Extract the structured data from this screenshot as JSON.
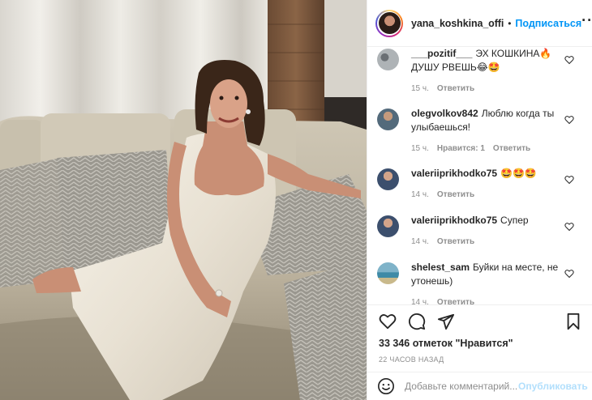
{
  "post": {
    "username": "yana_koshkina_offi",
    "separator": "•",
    "follow_label": "Подписаться",
    "more_label": "···",
    "comments": [
      {
        "username": "___pozitif___",
        "text": "ЭХ КОШКИНА🔥 ДУШУ РВЕШЬ😂🤩",
        "time": "15 ч.",
        "likes": "",
        "reply": "Ответить"
      },
      {
        "username": "olegvolkov842",
        "text": "Люблю когда ты улыбаешься!",
        "time": "15 ч.",
        "likes": "Нравится: 1",
        "reply": "Ответить"
      },
      {
        "username": "valeriiprikhodko75",
        "text": "🤩🤩🤩",
        "time": "14 ч.",
        "likes": "",
        "reply": "Ответить"
      },
      {
        "username": "valeriiprikhodko75",
        "text": "Супер",
        "time": "14 ч.",
        "likes": "",
        "reply": "Ответить"
      },
      {
        "username": "shelest_sam",
        "text": "Буйки на месте, не утонешь)",
        "time": "14 ч.",
        "likes": "",
        "reply": "Ответить"
      }
    ],
    "like_count": "33 346 отметок \"Нравится\"",
    "timestamp": "22 ЧАСОВ НАЗАД",
    "comment_placeholder": "Добавьте комментарий...",
    "publish_label": "Опубликовать"
  },
  "icons": {
    "heart": "heart-icon",
    "comment": "comment-icon",
    "share": "paper-plane-icon",
    "save": "bookmark-icon",
    "emoji": "smiley-icon"
  },
  "colors": {
    "accent": "#0095f6",
    "publish_disabled": "#b2dffc",
    "muted": "#8e8e8e"
  }
}
